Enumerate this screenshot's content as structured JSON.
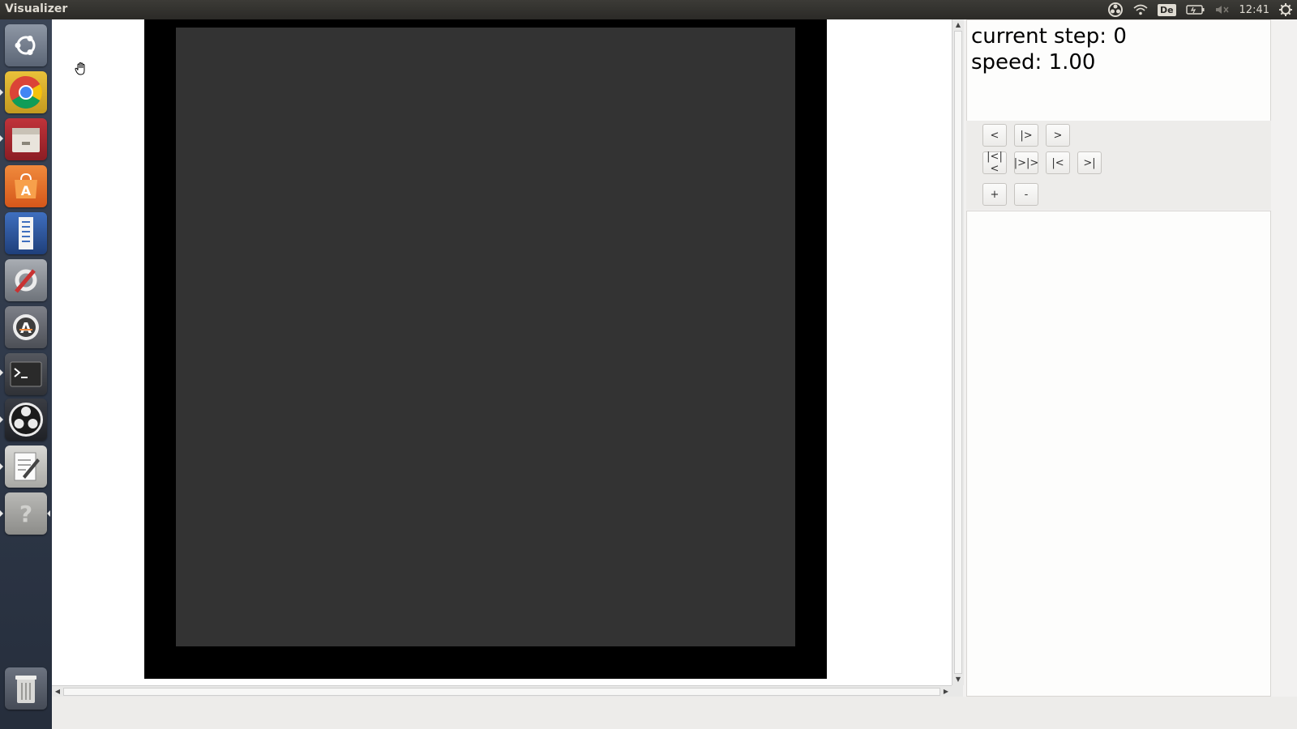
{
  "window": {
    "title": "Visualizer"
  },
  "tray": {
    "language": "De",
    "clock": "12:41",
    "icons": [
      "obs-tray-icon",
      "wifi-icon",
      "keyboard-language-indicator",
      "battery-icon",
      "volume-muted-icon",
      "gear-icon"
    ]
  },
  "launcher": {
    "items": [
      {
        "name": "ubuntu-dash",
        "icon": "ubuntu-logo-icon"
      },
      {
        "name": "chrome",
        "icon": "chrome-icon"
      },
      {
        "name": "files",
        "icon": "file-manager-icon"
      },
      {
        "name": "software-center",
        "icon": "software-center-icon"
      },
      {
        "name": "libreoffice-writer",
        "icon": "document-icon"
      },
      {
        "name": "system-settings",
        "icon": "settings-icon"
      },
      {
        "name": "software-updater",
        "icon": "updater-icon"
      },
      {
        "name": "terminal",
        "icon": "terminal-icon"
      },
      {
        "name": "obs-studio",
        "icon": "obs-icon"
      },
      {
        "name": "text-editor",
        "icon": "text-editor-icon"
      },
      {
        "name": "help",
        "icon": "help-icon"
      },
      {
        "name": "trash",
        "icon": "trash-icon"
      }
    ]
  },
  "info": {
    "current_step": "current step: 0",
    "speed": "speed: 1.00"
  },
  "controls": {
    "row1": [
      "<",
      "|>",
      ">"
    ],
    "row2": [
      "|<|<",
      "|>|>",
      "|<",
      ">|"
    ],
    "row3": [
      "+",
      "-"
    ]
  },
  "colors": {
    "board_border": "#000000",
    "board_fill": "#333333",
    "panel_bg": "#fdfdfc",
    "topbar": "#2b2a27"
  }
}
